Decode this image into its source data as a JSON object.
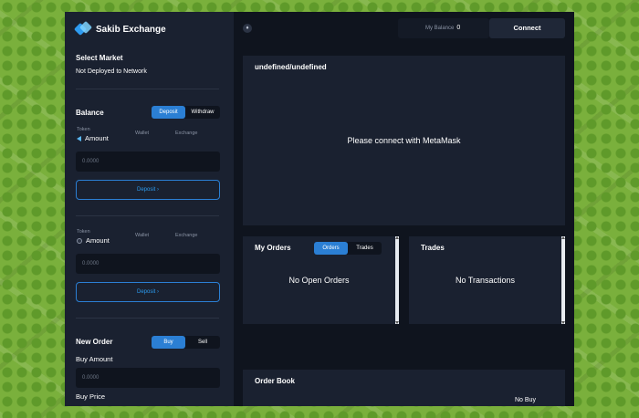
{
  "brand": {
    "name": "Sakib Exchange"
  },
  "sidebar": {
    "select_market": {
      "title": "Select Market",
      "value": "Not Deployed to Network"
    },
    "balance": {
      "title": "Balance",
      "tabs": [
        "Deposit",
        "Withdraw"
      ],
      "token1": {
        "token_label": "Token",
        "amount_label": "Amount",
        "wallet_label": "Wallet",
        "exchange_label": "Exchange",
        "placeholder": "0.0000",
        "button": "Deposit  ›"
      },
      "token2": {
        "token_label": "Token",
        "amount_label": "Amount",
        "wallet_label": "Wallet",
        "exchange_label": "Exchange",
        "placeholder": "0.0000",
        "button": "Deposit  ›"
      }
    },
    "new_order": {
      "title": "New Order",
      "tabs": [
        "Buy",
        "Sell"
      ],
      "buy_amount_label": "Buy Amount",
      "buy_amount_placeholder": "0.0000",
      "buy_price_label": "Buy Price"
    }
  },
  "topbar": {
    "balance_label": "My Balance",
    "balance_value": "0",
    "connect_label": "Connect",
    "network_icon": "ethereum-icon"
  },
  "chart_panel": {
    "title": "undefined/undefined",
    "message": "Please connect with MetaMask"
  },
  "my_orders": {
    "title": "My Orders",
    "tabs": [
      "Orders",
      "Trades"
    ],
    "empty": "No Open Orders"
  },
  "trades": {
    "title": "Trades",
    "empty": "No Transactions"
  },
  "order_book": {
    "title": "Order Book",
    "buy_empty": "No Buy"
  },
  "colors": {
    "accent": "#2b7fd4",
    "panel": "#1a2130",
    "background": "#0f141e"
  }
}
